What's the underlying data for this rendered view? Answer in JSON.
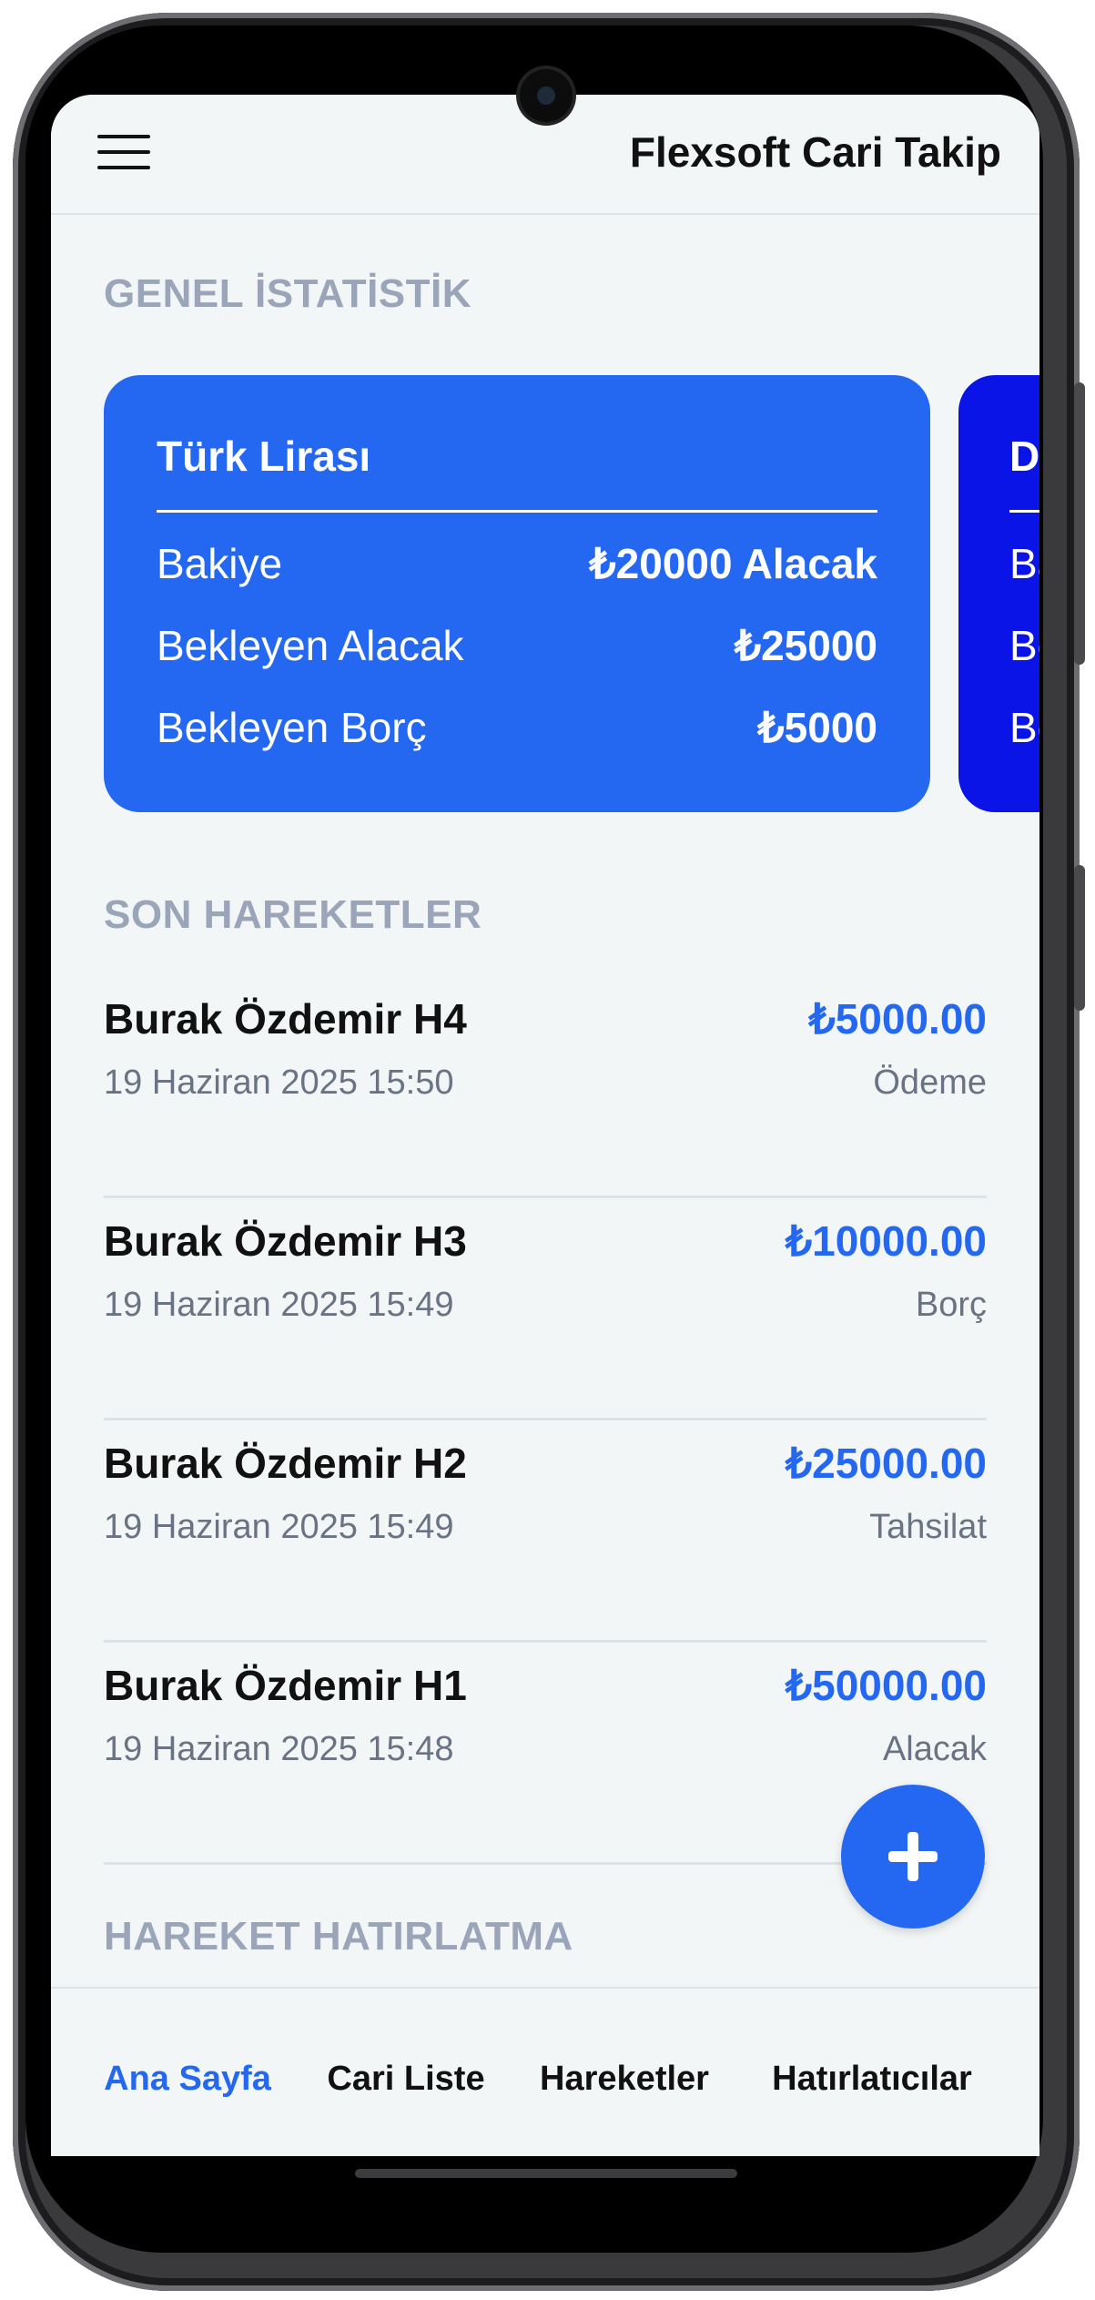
{
  "header": {
    "title": "Flexsoft Cari Takip",
    "menu_icon": "hamburger-menu-icon"
  },
  "stats": {
    "section_title": "GENEL İSTATİSTİK",
    "cards": [
      {
        "title": "Türk Lirası",
        "color": "#2468f2",
        "rows": [
          {
            "label": "Bakiye",
            "value": "₺20000 Alacak"
          },
          {
            "label": "Bekleyen Alacak",
            "value": "₺25000"
          },
          {
            "label": "Bekleyen Borç",
            "value": "₺5000"
          }
        ]
      },
      {
        "title": "Do",
        "color": "#0b14e6",
        "rows": [
          {
            "label": "Ba"
          },
          {
            "label": "Be"
          },
          {
            "label": "Be"
          }
        ]
      }
    ]
  },
  "transactions": {
    "section_title": "SON HAREKETLER",
    "items": [
      {
        "name": "Burak Özdemir H4",
        "date": "19 Haziran 2025 15:50",
        "amount": "₺5000.00",
        "type": "Ödeme"
      },
      {
        "name": "Burak Özdemir H3",
        "date": "19 Haziran 2025 15:49",
        "amount": "₺10000.00",
        "type": "Borç"
      },
      {
        "name": "Burak Özdemir H2",
        "date": "19 Haziran 2025 15:49",
        "amount": "₺25000.00",
        "type": "Tahsilat"
      },
      {
        "name": "Burak Özdemir H1",
        "date": "19 Haziran 2025 15:48",
        "amount": "₺50000.00",
        "type": "Alacak"
      }
    ]
  },
  "reminders": {
    "section_title": "HAREKET HATIRLATMA"
  },
  "fab": {
    "icon": "plus-icon",
    "color": "#2468f2"
  },
  "bottom_nav": {
    "items": [
      {
        "label": "Ana Sayfa",
        "active": true
      },
      {
        "label": "Cari Liste",
        "active": false
      },
      {
        "label": "Hareketler",
        "active": false
      },
      {
        "label": "Hatırlatıcılar",
        "active": false
      }
    ],
    "active_color": "#2468f2"
  }
}
